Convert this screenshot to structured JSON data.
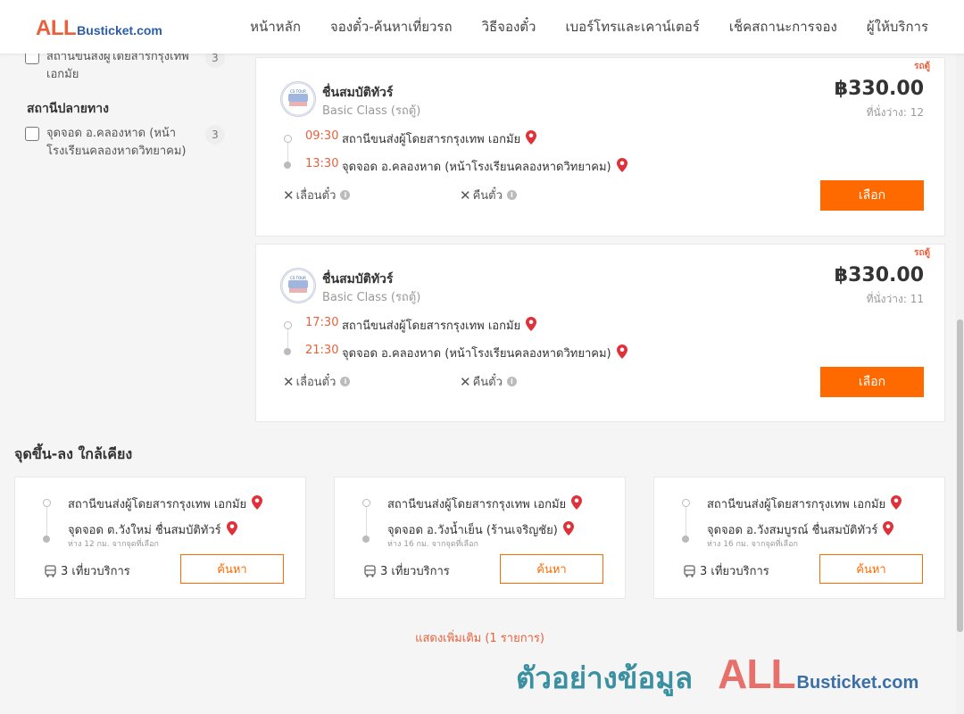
{
  "header": {
    "logo_all": "ALL",
    "logo_rest": "Busticket.com",
    "nav": [
      "หน้าหลัก",
      "จองตั๋ว-ค้นหาเที่ยวรถ",
      "วิธีจองตั๋ว",
      "เบอร์โทรและเคาน์เตอร์",
      "เช็คสถานะการจอง",
      "ผู้ให้บริการ"
    ]
  },
  "filters": {
    "origin_item": {
      "label": "สถานีขนส่งผู้โดยสารกรุงเทพ เอกมัย",
      "count": "3"
    },
    "dest_heading": "สถานีปลายทาง",
    "dest_item": {
      "label": "จุดจอด อ.คลองหาด (หน้าโรงเรียนคลองหาดวิทยาคม)",
      "count": "3"
    }
  },
  "trips": [
    {
      "tag": "รถตู้",
      "operator": "ชื่นสมบัติทัวร์",
      "class": "Basic Class (รถตู้)",
      "price": "฿330.00",
      "seats": "ที่นั่งว่าง: 12",
      "dep_time": "09:30",
      "dep_place": "สถานีขนส่งผู้โดยสารกรุงเทพ เอกมัย",
      "arr_time": "13:30",
      "arr_place": "จุดจอด อ.คลองหาด (หน้าโรงเรียนคลองหาดวิทยาคม)",
      "policy_change": "เลื่อนตั๋ว",
      "policy_refund": "คืนตั๋ว",
      "select_label": "เลือก"
    },
    {
      "tag": "รถตู้",
      "operator": "ชื่นสมบัติทัวร์",
      "class": "Basic Class (รถตู้)",
      "price": "฿330.00",
      "seats": "ที่นั่งว่าง: 11",
      "dep_time": "17:30",
      "dep_place": "สถานีขนส่งผู้โดยสารกรุงเทพ เอกมัย",
      "arr_time": "21:30",
      "arr_place": "จุดจอด อ.คลองหาด (หน้าโรงเรียนคลองหาดวิทยาคม)",
      "policy_change": "เลื่อนตั๋ว",
      "policy_refund": "คืนตั๋ว",
      "select_label": "เลือก"
    }
  ],
  "nearby": {
    "title": "จุดขึ้น-ลง ใกล้เคียง",
    "items": [
      {
        "from": "สถานีขนส่งผู้โดยสารกรุงเทพ เอกมัย",
        "to": "จุดจอด ต.วังใหม่ ชื่นสมบัติทัวร์",
        "dist": "ห่าง 12 กม. จากจุดที่เลือก",
        "trips": "3 เที่ยวบริการ",
        "search_label": "ค้นหา"
      },
      {
        "from": "สถานีขนส่งผู้โดยสารกรุงเทพ เอกมัย",
        "to": "จุดจอด อ.วังน้ำเย็น (ร้านเจริญชัย)",
        "dist": "ห่าง 16 กม. จากจุดที่เลือก",
        "trips": "3 เที่ยวบริการ",
        "search_label": "ค้นหา"
      },
      {
        "from": "สถานีขนส่งผู้โดยสารกรุงเทพ เอกมัย",
        "to": "จุดจอด อ.วังสมบูรณ์ ชื่นสมบัติทัวร์",
        "dist": "ห่าง 16 กม. จากจุดที่เลือก",
        "trips": "3 เที่ยวบริการ",
        "search_label": "ค้นหา"
      }
    ],
    "show_more": "แสดงเพิ่มเติม (1 รายการ)"
  },
  "watermark": {
    "thai": "ตัวอย่างข้อมูล",
    "all": "ALL",
    "rest": "Busticket.com"
  },
  "colors": {
    "accent": "#ff6a00",
    "price_text": "#333333",
    "pin": "#e0303a"
  }
}
